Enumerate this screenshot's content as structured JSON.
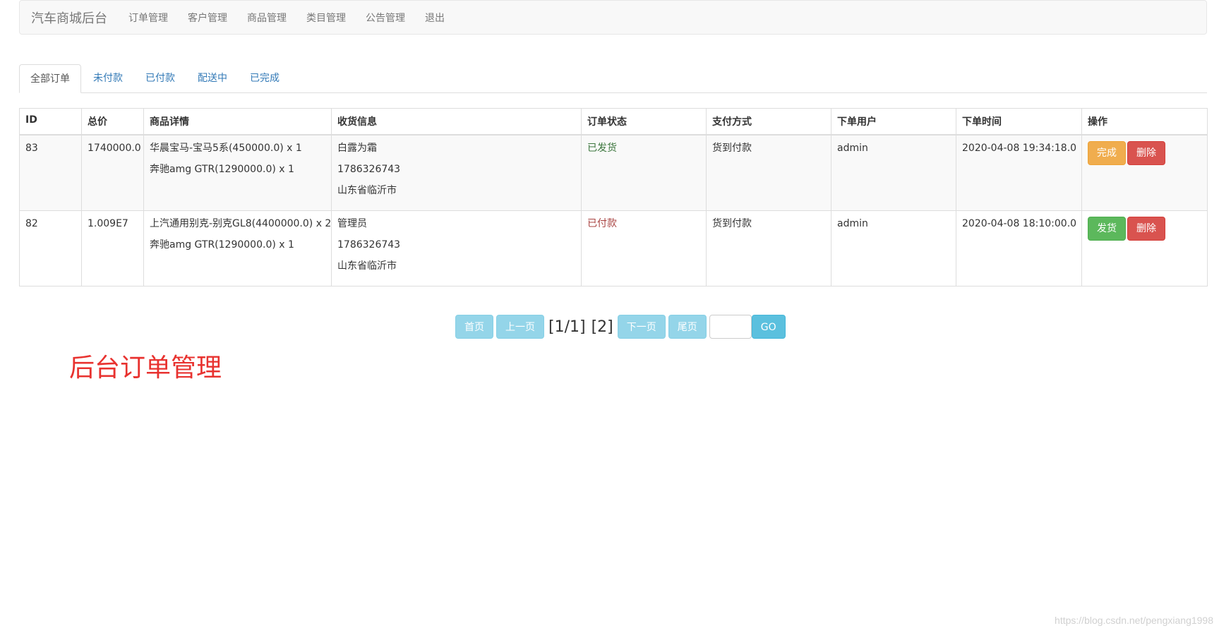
{
  "navbar": {
    "brand": "汽车商城后台",
    "items": [
      "订单管理",
      "客户管理",
      "商品管理",
      "类目管理",
      "公告管理",
      "退出"
    ]
  },
  "tabs": [
    "全部订单",
    "未付款",
    "已付款",
    "配送中",
    "已完成"
  ],
  "table": {
    "headers": [
      "ID",
      "总价",
      "商品详情",
      "收货信息",
      "订单状态",
      "支付方式",
      "下单用户",
      "下单时间",
      "操作"
    ],
    "rows": [
      {
        "id": "83",
        "total": "1740000.0",
        "items": [
          "华晨宝马-宝马5系(450000.0) x 1",
          "奔驰amg GTR(1290000.0) x 1"
        ],
        "shipping": [
          "白露为霜",
          "1786326743",
          "山东省临沂市"
        ],
        "status": "已发货",
        "payment": "货到付款",
        "user": "admin",
        "time": "2020-04-08 19:34:18.0",
        "actions": [
          "完成",
          "删除"
        ]
      },
      {
        "id": "82",
        "total": "1.009E7",
        "items": [
          "上汽通用别克-别克GL8(4400000.0) x 2",
          "奔驰amg GTR(1290000.0) x 1"
        ],
        "shipping": [
          "管理员",
          "1786326743",
          "山东省临沂市"
        ],
        "status": "已付款",
        "payment": "货到付款",
        "user": "admin",
        "time": "2020-04-08 18:10:00.0",
        "actions": [
          "发货",
          "删除"
        ]
      }
    ]
  },
  "pagination": {
    "first": "首页",
    "prev": "上一页",
    "page_info": "[1/1]",
    "total": "[2]",
    "next": "下一页",
    "last": "尾页",
    "input_value": "",
    "go": "GO"
  },
  "caption": "后台订单管理",
  "watermark": "https://blog.csdn.net/pengxiang1998"
}
